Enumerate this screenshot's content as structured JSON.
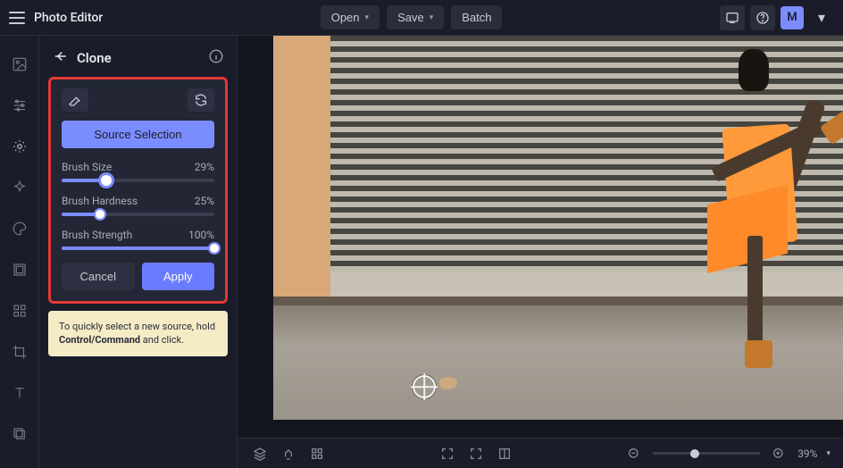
{
  "app": {
    "title": "Photo Editor"
  },
  "topbar": {
    "open_label": "Open",
    "save_label": "Save",
    "batch_label": "Batch",
    "avatar_letter": "M"
  },
  "left_tools": [
    "image-icon",
    "adjustments-icon",
    "retouch-icon",
    "sparkle-icon",
    "palette-icon",
    "frame-icon",
    "elements-icon",
    "crop-icon",
    "text-icon",
    "layers-icon"
  ],
  "panel": {
    "title": "Clone",
    "source_selection_label": "Source Selection",
    "sliders": [
      {
        "label": "Brush Size",
        "value": 29,
        "display": "29%"
      },
      {
        "label": "Brush Hardness",
        "value": 25,
        "display": "25%"
      },
      {
        "label": "Brush Strength",
        "value": 100,
        "display": "100%"
      }
    ],
    "cancel_label": "Cancel",
    "apply_label": "Apply"
  },
  "tip": {
    "text_before": "To quickly select a new source, hold ",
    "bold": "Control/Command",
    "text_after": " and click."
  },
  "zoom": {
    "display": "39%",
    "value": 39
  }
}
